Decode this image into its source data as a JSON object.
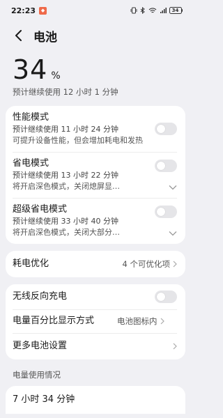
{
  "status_bar": {
    "time": "22:23",
    "battery_level": "34",
    "icons": [
      "vibrate-icon",
      "bluetooth-icon",
      "wifi-icon",
      "mobile-signal-icon",
      "battery-icon"
    ]
  },
  "header": {
    "title": "电池"
  },
  "battery": {
    "level": "34",
    "unit": "%",
    "remaining_text": "预计继续使用 12 小时 1 分钟"
  },
  "modes": [
    {
      "title": "性能模式",
      "sub": "预计继续使用 11 小时 24 分钟",
      "desc": "可提升设备性能，但会增加耗电和发热",
      "enabled": false
    },
    {
      "title": "省电模式",
      "sub": "预计继续使用 13 小时 22 分钟",
      "desc": "将开启深色模式，关闭熄屏显…",
      "enabled": false
    },
    {
      "title": "超级省电模式",
      "sub": "预计继续使用 33 小时 40 分钟",
      "desc": "将开启深色模式，关闭大部分…",
      "enabled": false
    }
  ],
  "optimization": {
    "title": "耗电优化",
    "value": "4 个可优化项"
  },
  "settings": {
    "reverse_charging": {
      "title": "无线反向充电",
      "enabled": false
    },
    "percentage_display": {
      "title": "电量百分比显示方式",
      "value": "电池图标内"
    },
    "more": {
      "title": "更多电池设置"
    }
  },
  "usage": {
    "section_title": "电量使用情况",
    "partial_value": "7 小时 34 分钟"
  },
  "colors": {
    "background": "#f0f0f4",
    "card": "#ffffff",
    "toggle_off": "#e5e5e8",
    "badge": "#ef6a4a"
  }
}
